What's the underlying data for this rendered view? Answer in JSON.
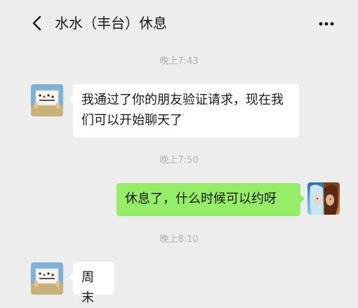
{
  "header": {
    "title": "水水（丰台）休息",
    "back_icon": "chevron-left-icon",
    "more_icon": "more-dots-icon"
  },
  "messages": [
    {
      "type": "time",
      "text": "晚上7:43"
    },
    {
      "type": "incoming",
      "text": "我通过了你的朋友验证请求，现在我们可以开始聊天了",
      "avatar": "contact-avatar"
    },
    {
      "type": "time",
      "text": "晚上7:50"
    },
    {
      "type": "outgoing",
      "text": "休息了，什么时候可以约呀",
      "avatar": "self-avatar"
    },
    {
      "type": "time",
      "text": "晚上8:10"
    },
    {
      "type": "incoming",
      "text": "周末",
      "avatar": "contact-avatar"
    }
  ],
  "colors": {
    "background": "#ededed",
    "incoming_bubble": "#ffffff",
    "outgoing_bubble": "#95ec69",
    "timestamp": "#b2b2b2"
  }
}
